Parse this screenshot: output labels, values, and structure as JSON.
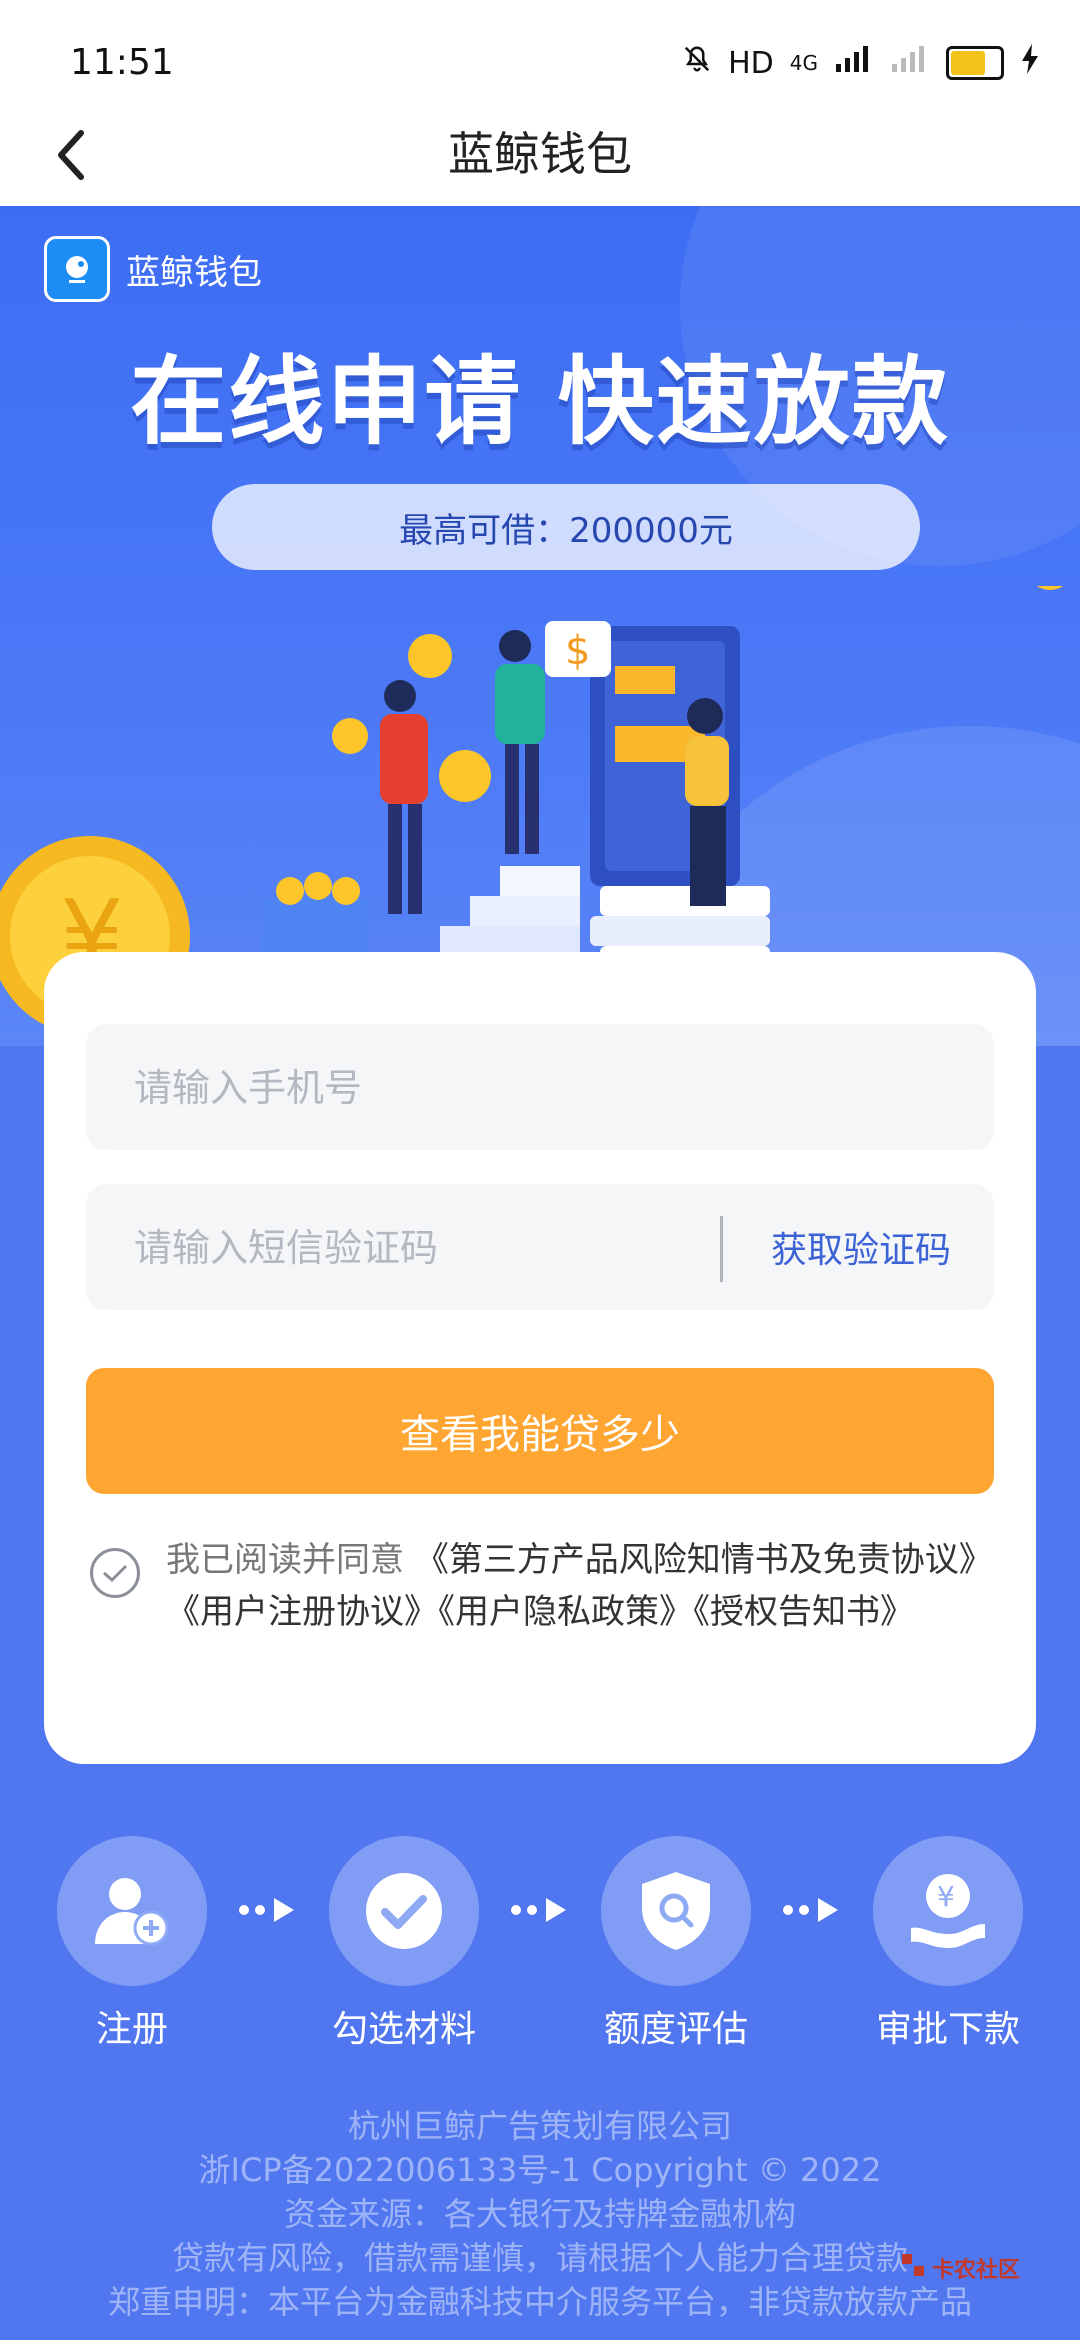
{
  "status": {
    "time": "11:51",
    "network": "HD",
    "signal": "4G"
  },
  "nav": {
    "title": "蓝鲸钱包"
  },
  "hero": {
    "brand": "蓝鲸钱包",
    "title": "在线申请 快速放款",
    "limit": "最高可借：200000元"
  },
  "form": {
    "phone_placeholder": "请输入手机号",
    "code_placeholder": "请输入短信验证码",
    "get_code": "获取验证码",
    "submit": "查看我能贷多少",
    "agree_prefix": "我已阅读并同意",
    "agree_links": "《第三方产品风险知情书及免责协议》《用户注册协议》《用户隐私政策》《授权告知书》"
  },
  "steps": [
    {
      "label": "注册",
      "icon": "user-add-icon"
    },
    {
      "label": "勾选材料",
      "icon": "check-icon"
    },
    {
      "label": "额度评估",
      "icon": "shield-search-icon"
    },
    {
      "label": "审批下款",
      "icon": "yuan-hand-icon"
    }
  ],
  "footer": {
    "line1": "杭州巨鲸广告策划有限公司",
    "line2": "浙ICP备2022006133号-1 Copyright © 2022",
    "line3": "资金来源：各大银行及持牌金融机构",
    "line4": "贷款有风险，借款需谨慎，请根据个人能力合理贷款",
    "line5": "郑重申明：本平台为金融科技中介服务平台，非贷款放款产品"
  },
  "watermark": "卡农社区",
  "colors": {
    "primary": "#4a78f7",
    "accent": "#ffa532",
    "link": "#3b63d6"
  }
}
